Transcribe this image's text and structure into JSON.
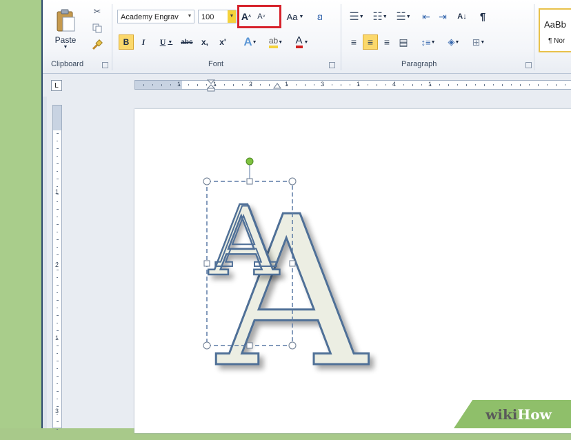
{
  "clipboard": {
    "paste_label": "Paste",
    "group_label": "Clipboard"
  },
  "font": {
    "font_name": "Academy Engrav",
    "font_size": "100",
    "group_label": "Font",
    "bold": "B",
    "italic": "I",
    "underline": "U",
    "strike": "abc",
    "subscript": "x,",
    "superscript": "x'",
    "change_case": "Aa",
    "grow": "A",
    "shrink": "A"
  },
  "paragraph": {
    "group_label": "Paragraph",
    "sort": "A↓",
    "show_marks": "¶"
  },
  "styles": {
    "sample": "AaBb",
    "name": "¶ Nor"
  },
  "ruler": {
    "numbers": [
      "1",
      "1",
      "2",
      "1",
      "3",
      "1",
      "4",
      "1"
    ]
  },
  "document": {
    "letter": "A"
  },
  "watermark": {
    "wiki": "wiki",
    "how": "How",
    "wiki_color": "#5a5a5a",
    "how_color": "#ffffff"
  },
  "colors": {
    "highlight_border": "#d6212b",
    "highlight_yellow": "#f5d23a",
    "font_red": "#d11f1f",
    "letter_fill": "#eceee3",
    "letter_outline": "#4f6f97",
    "rotate_handle": "#7fc241"
  }
}
